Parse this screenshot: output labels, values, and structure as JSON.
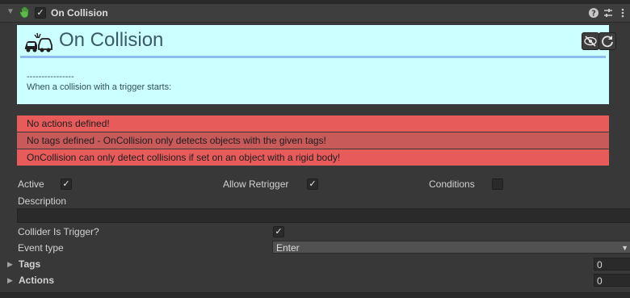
{
  "header": {
    "title": "On Collision",
    "enabled_check": "✓",
    "icons": [
      "hand-icon",
      "help-icon",
      "presets-icon",
      "menu-icon"
    ]
  },
  "panel": {
    "title": "On Collision",
    "separator": "----------------",
    "description": "When a collision with a trigger starts:",
    "icons": [
      "car-crash-icon",
      "hide-icon",
      "refresh-icon"
    ],
    "background": "#ccffff",
    "accent": "#8cbcf0"
  },
  "errors": [
    "No actions defined!",
    "No tags defined - OnCollision only detects objects with the given tags!",
    "OnCollision can only detect collisions if set on an object with a rigid body!"
  ],
  "error_color": "#e85b5b",
  "fields": {
    "active": {
      "label": "Active",
      "checked": "✓"
    },
    "allow_retrigger": {
      "label": "Allow Retrigger",
      "checked": "✓"
    },
    "conditions": {
      "label": "Conditions",
      "checked": ""
    },
    "description": {
      "label": "Description",
      "value": ""
    },
    "collider_is_trigger": {
      "label": "Collider Is Trigger?",
      "checked": "✓"
    },
    "event_type": {
      "label": "Event type",
      "value": "Enter"
    },
    "tags": {
      "label": "Tags",
      "count": "0"
    },
    "actions": {
      "label": "Actions",
      "count": "0"
    }
  }
}
